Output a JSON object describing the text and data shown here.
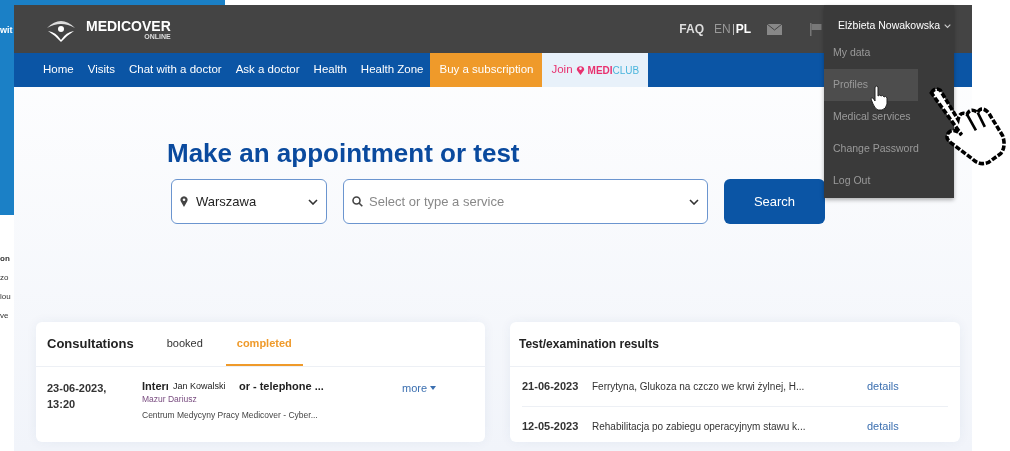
{
  "background_window": {
    "heading_fragment": "wit",
    "line_fragments": [
      "on",
      "zo",
      "lou",
      "ve"
    ]
  },
  "header": {
    "logo_text": "MEDICOVER",
    "logo_subtext": "ONLINE",
    "faq": "FAQ",
    "languages": [
      {
        "label": "EN",
        "selected": false
      },
      {
        "label": "PL",
        "selected": true
      }
    ],
    "user_name": "Elżbieta Nowakowska"
  },
  "nav": [
    {
      "label": "Home",
      "kind": "link"
    },
    {
      "label": "Visits",
      "kind": "link"
    },
    {
      "label": "Chat with a doctor",
      "kind": "link"
    },
    {
      "label": "Ask a doctor",
      "kind": "link"
    },
    {
      "label": "Health",
      "kind": "link"
    },
    {
      "label": "Health Zone",
      "kind": "link"
    },
    {
      "label": "Buy a subscription",
      "kind": "promo"
    },
    {
      "label": "Join",
      "kind": "club",
      "logo_bold": "MEDI",
      "logo_light": "CLUB"
    }
  ],
  "user_menu": [
    {
      "label": "My data",
      "selected": false
    },
    {
      "label": "Profiles",
      "selected": true
    },
    {
      "label": "Medical services",
      "selected": false
    },
    {
      "label": "Change Password",
      "selected": false
    },
    {
      "label": "Log Out",
      "selected": false
    }
  ],
  "appointment": {
    "title": "Make an appointment or test",
    "location": "Warszawa",
    "service_placeholder": "Select or type a service",
    "search_button": "Search"
  },
  "consultations": {
    "title": "Consultations",
    "tabs": [
      {
        "label": "booked",
        "selected": false
      },
      {
        "label": "completed",
        "selected": true
      }
    ],
    "rows": [
      {
        "date": "23-06-2023,",
        "time": "13:20",
        "title_start": "Interı",
        "title_end": "or - telephone ...",
        "doctor": "Mazur Dariusz",
        "clinic": "Centrum Medycyny Pracy Medicover - Cyber...",
        "more": "more"
      }
    ],
    "tooltip": "Jan Kowalski"
  },
  "results": {
    "title": "Test/examination results",
    "rows": [
      {
        "date": "21-06-2023",
        "description": "Ferrytyna, Glukoza na czczo we krwi żylnej, H...",
        "link": "details"
      },
      {
        "date": "12-05-2023",
        "description": "Rehabilitacja po zabiegu operacyjnym stawu k...",
        "link": "details"
      }
    ]
  }
}
